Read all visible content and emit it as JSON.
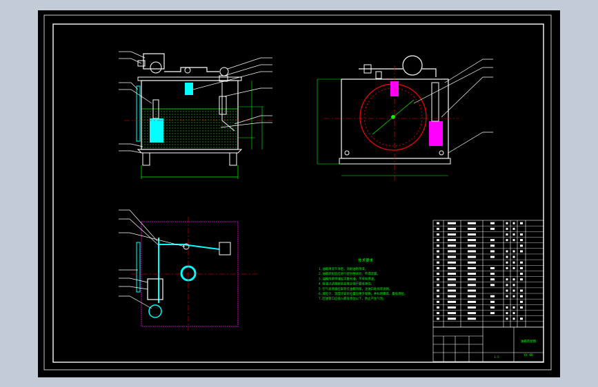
{
  "colors": {
    "window_bg": "#c3cbd6",
    "canvas_bg": "#000000",
    "border": "#ffffff",
    "part": "#ffffff",
    "dimension": "#00ff00",
    "centerline": "#ff0000",
    "accent_cyan": "#00ffff",
    "accent_magenta": "#ff00ff",
    "accent_yellow": "#ffff00",
    "section_hatch": "#00ff00"
  },
  "drawing": {
    "views": [
      "front-view",
      "side-view",
      "top-view"
    ],
    "notes_heading": "技术要求",
    "notes": [
      "1.油箱清洗干净后，涂耐油防锈漆。",
      "2.油箱装配后应进行密封性试验，不得渗漏。",
      "3.油箱内壁焊缝应平整光滑，不得有焊渣。",
      "4.吸油过滤器安装高度应低于最低液位。",
      "5.空气滤清器应安装在油箱顶部，注油口处加装滤网。",
      "6.液位计、温度计安装位置应便于观察，并标明最高、最低液位。",
      "7.回油管口应插入最低液位以下，防止产生气泡。"
    ]
  },
  "title_block": {
    "drawing_title": "油箱装配图",
    "drawing_number": "YX-00",
    "scale": "1:5"
  }
}
